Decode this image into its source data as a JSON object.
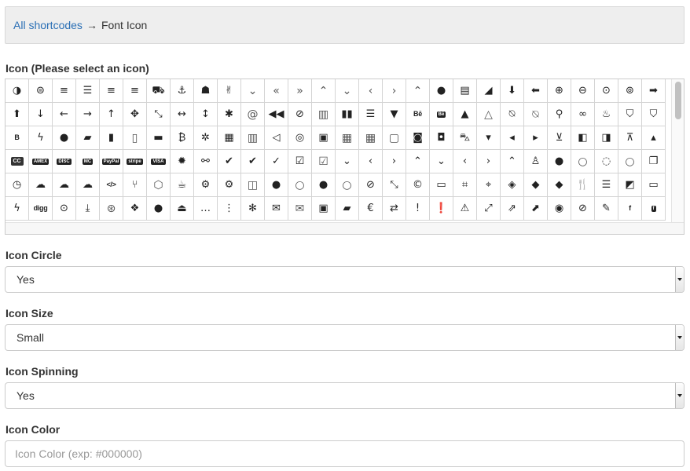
{
  "breadcrumb": {
    "link": "All shortcodes",
    "separator": "→",
    "current": "Font Icon"
  },
  "icon_picker": {
    "label": "Icon (Please select an icon)",
    "icons": [
      {
        "name": "adjust-icon",
        "g": "◑"
      },
      {
        "name": "adn-icon",
        "g": "⊜"
      },
      {
        "name": "align-center-icon",
        "g": "≡"
      },
      {
        "name": "align-justify-icon",
        "g": "☰"
      },
      {
        "name": "align-left-icon",
        "g": "≡"
      },
      {
        "name": "align-right-icon",
        "g": "≡"
      },
      {
        "name": "ambulance-icon",
        "g": "⛟"
      },
      {
        "name": "anchor-icon",
        "g": "⚓"
      },
      {
        "name": "android-icon",
        "g": "☗"
      },
      {
        "name": "angellist-icon",
        "g": "✌"
      },
      {
        "name": "angle-double-down-icon",
        "g": "⌄",
        "lt": 1
      },
      {
        "name": "angle-double-left-icon",
        "g": "«",
        "lt": 1
      },
      {
        "name": "angle-double-right-icon",
        "g": "»",
        "lt": 1
      },
      {
        "name": "angle-double-up-icon",
        "g": "⌃",
        "lt": 1
      },
      {
        "name": "angle-down-icon",
        "g": "⌄",
        "lt": 1
      },
      {
        "name": "angle-left-icon",
        "g": "‹",
        "lt": 1
      },
      {
        "name": "angle-right-icon",
        "g": "›",
        "lt": 1
      },
      {
        "name": "angle-up-icon",
        "g": "⌃",
        "lt": 1
      },
      {
        "name": "apple-icon",
        "g": "●"
      },
      {
        "name": "archive-icon",
        "g": "▤"
      },
      {
        "name": "area-chart-icon",
        "g": "◢"
      },
      {
        "name": "arrow-circle-down-icon",
        "g": "⬇"
      },
      {
        "name": "arrow-circle-left-icon",
        "g": "⬅"
      },
      {
        "name": "arrow-circle-o-down-icon",
        "g": "⊕"
      },
      {
        "name": "arrow-circle-o-left-icon",
        "g": "⊖"
      },
      {
        "name": "arrow-circle-o-right-icon",
        "g": "⊙"
      },
      {
        "name": "arrow-circle-o-up-icon",
        "g": "⊚"
      },
      {
        "name": "arrow-circle-right-icon",
        "g": "➡"
      },
      {
        "name": "arrow-circle-up-icon",
        "g": "⬆"
      },
      {
        "name": "arrow-down-icon",
        "g": "↓"
      },
      {
        "name": "arrow-left-icon",
        "g": "←"
      },
      {
        "name": "arrow-right-icon",
        "g": "→"
      },
      {
        "name": "arrow-up-icon",
        "g": "↑"
      },
      {
        "name": "arrows-icon",
        "g": "✥"
      },
      {
        "name": "arrows-alt-icon",
        "g": "⤡"
      },
      {
        "name": "arrows-h-icon",
        "g": "↔"
      },
      {
        "name": "arrows-v-icon",
        "g": "↕"
      },
      {
        "name": "asterisk-icon",
        "g": "✱"
      },
      {
        "name": "at-icon",
        "g": "@",
        "lt": 1
      },
      {
        "name": "backward-icon",
        "g": "◀◀"
      },
      {
        "name": "ban-icon",
        "g": "⊘"
      },
      {
        "name": "bar-chart-icon",
        "g": "▥",
        "lt": 1
      },
      {
        "name": "barcode-icon",
        "g": "▮▮"
      },
      {
        "name": "bars-icon",
        "g": "☰"
      },
      {
        "name": "beer-icon",
        "g": "▼"
      },
      {
        "name": "behance-icon",
        "g": "Bē",
        "t": 1
      },
      {
        "name": "behance-square-icon",
        "g": "Bē",
        "b": 1
      },
      {
        "name": "bell-icon",
        "g": "▲"
      },
      {
        "name": "bell-o-icon",
        "g": "△",
        "lt": 1
      },
      {
        "name": "bell-slash-icon",
        "g": "⍉"
      },
      {
        "name": "bell-slash-o-icon",
        "g": "⍉",
        "lt": 1
      },
      {
        "name": "bicycle-icon",
        "g": "⚲"
      },
      {
        "name": "binoculars-icon",
        "g": "∞"
      },
      {
        "name": "birthday-cake-icon",
        "g": "♨"
      },
      {
        "name": "bitbucket-icon",
        "g": "⛉"
      },
      {
        "name": "bitbucket-square-icon",
        "g": "⛉"
      },
      {
        "name": "bold-icon",
        "g": "B",
        "t": 1
      },
      {
        "name": "bolt-icon",
        "g": "ϟ"
      },
      {
        "name": "bomb-icon",
        "g": "●"
      },
      {
        "name": "book-icon",
        "g": "▰"
      },
      {
        "name": "bookmark-icon",
        "g": "▮"
      },
      {
        "name": "bookmark-o-icon",
        "g": "▯",
        "lt": 1
      },
      {
        "name": "briefcase-icon",
        "g": "▬"
      },
      {
        "name": "btc-icon",
        "g": "₿"
      },
      {
        "name": "bug-icon",
        "g": "✲"
      },
      {
        "name": "building-icon",
        "g": "▦"
      },
      {
        "name": "building-o-icon",
        "g": "▥",
        "lt": 1
      },
      {
        "name": "bullhorn-icon",
        "g": "◁"
      },
      {
        "name": "bullseye-icon",
        "g": "◎"
      },
      {
        "name": "bus-icon",
        "g": "▣"
      },
      {
        "name": "calculator-icon",
        "g": "▦",
        "lt": 1
      },
      {
        "name": "calendar-icon",
        "g": "▦",
        "lt": 1
      },
      {
        "name": "calendar-o-icon",
        "g": "▢",
        "lt": 1
      },
      {
        "name": "camera-icon",
        "g": "◙"
      },
      {
        "name": "camera-retro-icon",
        "g": "◘"
      },
      {
        "name": "car-icon",
        "g": "⛍"
      },
      {
        "name": "caret-down-icon",
        "g": "▾"
      },
      {
        "name": "caret-left-icon",
        "g": "◂"
      },
      {
        "name": "caret-right-icon",
        "g": "▸"
      },
      {
        "name": "caret-square-o-down-icon",
        "g": "⊻"
      },
      {
        "name": "caret-square-o-left-icon",
        "g": "◧"
      },
      {
        "name": "caret-square-o-right-icon",
        "g": "◨"
      },
      {
        "name": "caret-square-o-up-icon",
        "g": "⊼"
      },
      {
        "name": "caret-up-icon",
        "g": "▴"
      },
      {
        "name": "cc-icon",
        "g": "CC",
        "c": 1
      },
      {
        "name": "cc-amex-icon",
        "g": "AMEX",
        "b": 1
      },
      {
        "name": "cc-discover-icon",
        "g": "DISC",
        "b": 1
      },
      {
        "name": "cc-mastercard-icon",
        "g": "MC",
        "b": 1
      },
      {
        "name": "cc-paypal-icon",
        "g": "PayPal",
        "b": 1
      },
      {
        "name": "cc-stripe-icon",
        "g": "stripe",
        "b": 1
      },
      {
        "name": "cc-visa-icon",
        "g": "VISA",
        "b": 1
      },
      {
        "name": "certificate-icon",
        "g": "✹"
      },
      {
        "name": "chain-broken-icon",
        "g": "⚯"
      },
      {
        "name": "check-icon",
        "g": "✔"
      },
      {
        "name": "check-circle-icon",
        "g": "✔"
      },
      {
        "name": "check-circle-o-icon",
        "g": "✓"
      },
      {
        "name": "check-square-icon",
        "g": "☑"
      },
      {
        "name": "check-square-o-icon",
        "g": "☑",
        "lt": 1
      },
      {
        "name": "chevron-circle-down-icon",
        "g": "⌄"
      },
      {
        "name": "chevron-circle-left-icon",
        "g": "‹"
      },
      {
        "name": "chevron-circle-right-icon",
        "g": "›"
      },
      {
        "name": "chevron-circle-up-icon",
        "g": "⌃"
      },
      {
        "name": "chevron-down-icon",
        "g": "⌄"
      },
      {
        "name": "chevron-left-icon",
        "g": "‹"
      },
      {
        "name": "chevron-right-icon",
        "g": "›"
      },
      {
        "name": "chevron-up-icon",
        "g": "⌃"
      },
      {
        "name": "child-icon",
        "g": "♙"
      },
      {
        "name": "circle-icon",
        "g": "●"
      },
      {
        "name": "circle-o-icon",
        "g": "○",
        "lt": 1
      },
      {
        "name": "circle-o-notch-icon",
        "g": "◌"
      },
      {
        "name": "circle-thin-icon",
        "g": "○",
        "lt": 1
      },
      {
        "name": "clipboard-icon",
        "g": "❐"
      },
      {
        "name": "clock-o-icon",
        "g": "◷"
      },
      {
        "name": "cloud-icon",
        "g": "☁"
      },
      {
        "name": "cloud-download-icon",
        "g": "☁"
      },
      {
        "name": "cloud-upload-icon",
        "g": "☁"
      },
      {
        "name": "code-icon",
        "g": "</>",
        "t": 1
      },
      {
        "name": "code-fork-icon",
        "g": "⑂"
      },
      {
        "name": "codepen-icon",
        "g": "⬡",
        "lt": 1
      },
      {
        "name": "coffee-icon",
        "g": "☕"
      },
      {
        "name": "cog-icon",
        "g": "⚙"
      },
      {
        "name": "cogs-icon",
        "g": "⚙"
      },
      {
        "name": "columns-icon",
        "g": "◫",
        "lt": 1
      },
      {
        "name": "comment-icon",
        "g": "●"
      },
      {
        "name": "comment-o-icon",
        "g": "○",
        "lt": 1
      },
      {
        "name": "comments-icon",
        "g": "●"
      },
      {
        "name": "comments-o-icon",
        "g": "○",
        "lt": 1
      },
      {
        "name": "compass-icon",
        "g": "⊘"
      },
      {
        "name": "compress-icon",
        "g": "⤡"
      },
      {
        "name": "copyright-icon",
        "g": "©"
      },
      {
        "name": "credit-card-icon",
        "g": "▭"
      },
      {
        "name": "crop-icon",
        "g": "⌗"
      },
      {
        "name": "crosshairs-icon",
        "g": "⌖"
      },
      {
        "name": "css3-icon",
        "g": "◈"
      },
      {
        "name": "cube-icon",
        "g": "◆"
      },
      {
        "name": "cubes-icon",
        "g": "◆"
      },
      {
        "name": "cutlery-icon",
        "g": "🍴"
      },
      {
        "name": "database-icon",
        "g": "☰"
      },
      {
        "name": "delicious-icon",
        "g": "◩"
      },
      {
        "name": "desktop-icon",
        "g": "▭"
      },
      {
        "name": "deviantart-icon",
        "g": "ϟ"
      },
      {
        "name": "digg-icon",
        "g": "digg",
        "t": 1
      },
      {
        "name": "dot-circle-o-icon",
        "g": "⊙"
      },
      {
        "name": "download-icon",
        "g": "⤓"
      },
      {
        "name": "dribbble-icon",
        "g": "⊛",
        "lt": 1
      },
      {
        "name": "dropbox-icon",
        "g": "❖"
      },
      {
        "name": "drupal-icon",
        "g": "●"
      },
      {
        "name": "eject-icon",
        "g": "⏏"
      },
      {
        "name": "ellipsis-h-icon",
        "g": "…"
      },
      {
        "name": "ellipsis-v-icon",
        "g": "⋮"
      },
      {
        "name": "empire-icon",
        "g": "✻"
      },
      {
        "name": "envelope-icon",
        "g": "✉"
      },
      {
        "name": "envelope-o-icon",
        "g": "✉",
        "lt": 1
      },
      {
        "name": "envelope-square-icon",
        "g": "▣"
      },
      {
        "name": "eraser-icon",
        "g": "▰"
      },
      {
        "name": "eur-icon",
        "g": "€"
      },
      {
        "name": "exchange-icon",
        "g": "⇄"
      },
      {
        "name": "exclamation-icon",
        "g": "!"
      },
      {
        "name": "exclamation-circle-icon",
        "g": "❗"
      },
      {
        "name": "exclamation-triangle-icon",
        "g": "⚠"
      },
      {
        "name": "expand-icon",
        "g": "⤢"
      },
      {
        "name": "external-link-icon",
        "g": "⇗"
      },
      {
        "name": "external-link-square-icon",
        "g": "⬈"
      },
      {
        "name": "eye-icon",
        "g": "◉"
      },
      {
        "name": "eye-slash-icon",
        "g": "⊘"
      },
      {
        "name": "eyedropper-icon",
        "g": "✎"
      },
      {
        "name": "facebook-icon",
        "g": "f",
        "t": 1
      },
      {
        "name": "facebook-square-icon",
        "g": "f",
        "b": 1
      }
    ]
  },
  "icon_circle": {
    "label": "Icon Circle",
    "value": "Yes"
  },
  "icon_size": {
    "label": "Icon Size",
    "value": "Small"
  },
  "icon_spinning": {
    "label": "Icon Spinning",
    "value": "Yes"
  },
  "icon_color": {
    "label": "Icon Color",
    "placeholder": "Icon Color (exp: #000000)",
    "value": ""
  }
}
